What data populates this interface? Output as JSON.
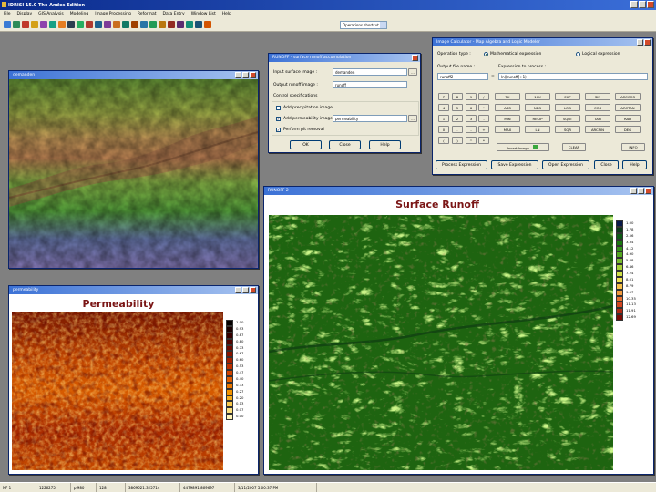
{
  "app": {
    "title": "IDRISI 15.0    The Andes Edition"
  },
  "menu": [
    "File",
    "Display",
    "GIS Analysis",
    "Modeling",
    "Image Processing",
    "Reformat",
    "Data Entry",
    "Window List",
    "Help"
  ],
  "toolbar": {
    "operations_select": "Operations shortcut",
    "icons": [
      "open-icon",
      "save-icon",
      "print-icon",
      "display-icon",
      "composite-icon",
      "palette-icon",
      "symbol-icon",
      "zoom-icon",
      "legend-icon",
      "query-icon",
      "metadata-icon",
      "database-icon",
      "profile-icon",
      "histogram-icon",
      "stats-icon",
      "map-icon",
      "layer-icon",
      "digitize-icon",
      "delete-icon",
      "save-edit-icon",
      "shapes-icon",
      "help-icon",
      "navigate-icon"
    ]
  },
  "windows": {
    "elevation": {
      "title": "demanden"
    },
    "permeability": {
      "title": "permeability",
      "chart_title": "Permeability",
      "legend_values": [
        "1.00",
        "0.93",
        "0.87",
        "0.80",
        "0.73",
        "0.67",
        "0.60",
        "0.53",
        "0.47",
        "0.40",
        "0.33",
        "0.27",
        "0.20",
        "0.13",
        "0.07",
        "0.00"
      ],
      "legend_colors": [
        "#050000",
        "#1a0000",
        "#360000",
        "#520400",
        "#6e0a00",
        "#8a1400",
        "#a42000",
        "#bd3000",
        "#d14400",
        "#e05c00",
        "#ea7700",
        "#f29300",
        "#f6ae1c",
        "#f9c84c",
        "#fce07e",
        "#fff4b8"
      ]
    },
    "runoff_dialog": {
      "title": "RUNOFF - surface runoff accumulation",
      "input_label": "Input surface image :",
      "input_value": "demanden",
      "output_label": "Output runoff image :",
      "output_value": "runoff",
      "control_label": "Control specifications",
      "precip_label": "Add precipitation image",
      "perm_label": "Add permeability image",
      "perm_value": "permeability",
      "pit_label": "Perform pit removal",
      "ok": "OK",
      "close": "Close",
      "help": "Help",
      "browse": "..."
    },
    "calculator": {
      "title": "Image Calculator - Map Algebra and Logic Modeler",
      "op_type_label": "Operation type :",
      "math_label": "Mathematical expression",
      "logic_label": "Logical expression",
      "outfile_label": "Output file name :",
      "outfile_value": "runoff2",
      "expr_label": "Expression to process :",
      "expr_value": "ln([runoff]+1)",
      "equals": "=",
      "numpad": [
        "7",
        "8",
        "9",
        "4",
        "5",
        "6",
        "1",
        "2",
        "3",
        "0",
        ".",
        "-",
        "(",
        ")",
        "^"
      ],
      "ops": [
        "/",
        "*",
        "-",
        "+",
        "*"
      ],
      "funcs": [
        "TX",
        "10X",
        "EXP",
        "SIN",
        "ARCCOS",
        "ABS",
        "NEG",
        "LOG",
        "COS",
        "ARCTAN",
        "MIN",
        "RECIP",
        "SQRT",
        "TAN",
        "RAD",
        "MAX",
        "LN",
        "SQR",
        "ARCSIN",
        "DEG"
      ],
      "insert_image": "Insert Image",
      "clear": "CLEAR",
      "info": "INFO",
      "process": "Process Expression",
      "save_expr": "Save Expression",
      "open_expr": "Open Expression",
      "close": "Close",
      "help": "Help"
    },
    "runoff2": {
      "title": "RUNOFF 2",
      "chart_title": "Surface Runoff",
      "legend_values": [
        "1.00",
        "1.78",
        "2.56",
        "3.34",
        "4.12",
        "4.90",
        "5.68",
        "6.46",
        "7.24",
        "8.01",
        "8.79",
        "9.57",
        "10.35",
        "11.13",
        "11.91",
        "12.69"
      ],
      "legend_colors": [
        "#0a1a4a",
        "#0a3a1a",
        "#0d5a15",
        "#1a7a10",
        "#34941a",
        "#56a822",
        "#7abd2e",
        "#a8d23a",
        "#cfe046",
        "#f0e050",
        "#f6c04a",
        "#f29a3e",
        "#e87030",
        "#d24620",
        "#b02812",
        "#7a0c06"
      ]
    }
  },
  "status": [
    "NF 1",
    "1226275",
    "p 980",
    "128",
    "3869621.325714",
    "4479891.869697",
    "3/11/2007 5:00:37 PM"
  ]
}
